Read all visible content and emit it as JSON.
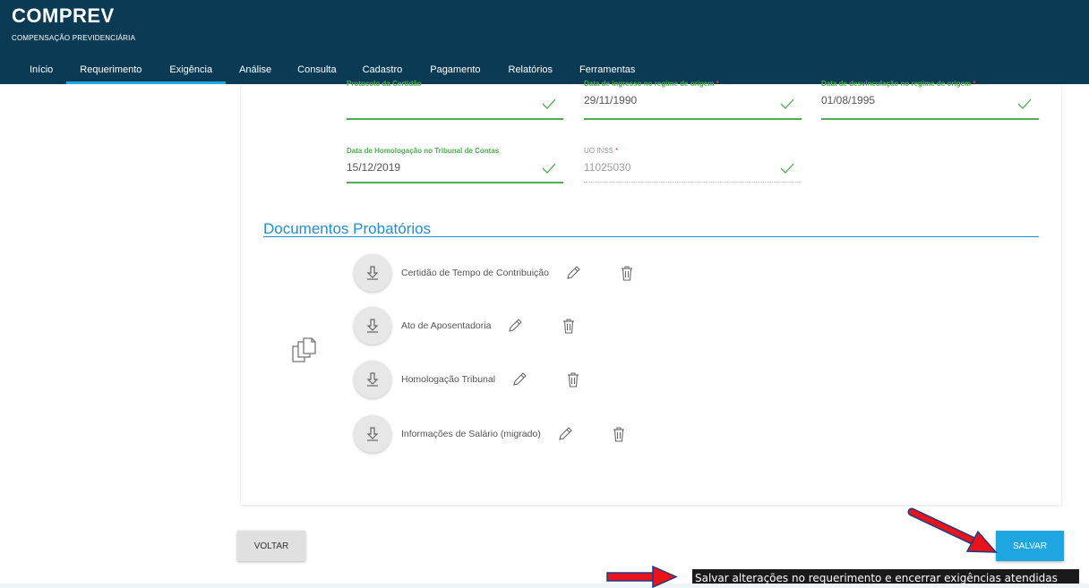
{
  "app": {
    "title": "COMPREV",
    "subtitle": "COMPENSAÇÃO PREVIDENCIÁRIA"
  },
  "nav": {
    "items": [
      {
        "label": "Início"
      },
      {
        "label": "Requerimento"
      },
      {
        "label": "Exigência"
      },
      {
        "label": "Análise"
      },
      {
        "label": "Consulta"
      },
      {
        "label": "Cadastro"
      },
      {
        "label": "Pagamento"
      },
      {
        "label": "Relatórios"
      },
      {
        "label": "Ferramentas"
      }
    ],
    "active": "Exigência"
  },
  "form": {
    "protocolo": {
      "label": "Protocolo da Certidão",
      "value": ""
    },
    "data_ingresso": {
      "label": "Data de ingresso no regime de origem",
      "required": "*",
      "value": "29/11/1990"
    },
    "data_desvinculacao": {
      "label": "Data de desvinculação no regime de origem",
      "required": "*",
      "value": "01/08/1995"
    },
    "data_homologacao": {
      "label": "Data de Homologação no Tribunal de Contas",
      "value": "15/12/2019"
    },
    "uo_inss": {
      "label": "UO INSS",
      "required": "*",
      "value": "11025030"
    }
  },
  "documents": {
    "section_title": "Documentos Probatórios",
    "items": [
      {
        "name": "Certidão de Tempo de Contribuição"
      },
      {
        "name": "Ato de Aposentadoria"
      },
      {
        "name": "Homologação Tribunal"
      },
      {
        "name": "Informações de Salário (migrado)"
      }
    ]
  },
  "actions": {
    "back_label": "VOLTAR",
    "save_label": "SALVAR",
    "save_tooltip": "Salvar alterações no requerimento e encerrar exigências atendidas"
  },
  "colors": {
    "header_bg": "#0b3a55",
    "accent_blue": "#1ea6e0",
    "field_green": "#4caf50",
    "annotation_arrow": "#e8141a"
  },
  "icons": [
    "download-icon",
    "edit-pencil-icon",
    "trash-icon",
    "documents-stack-icon",
    "check-icon",
    "red-arrow-annotation"
  ]
}
